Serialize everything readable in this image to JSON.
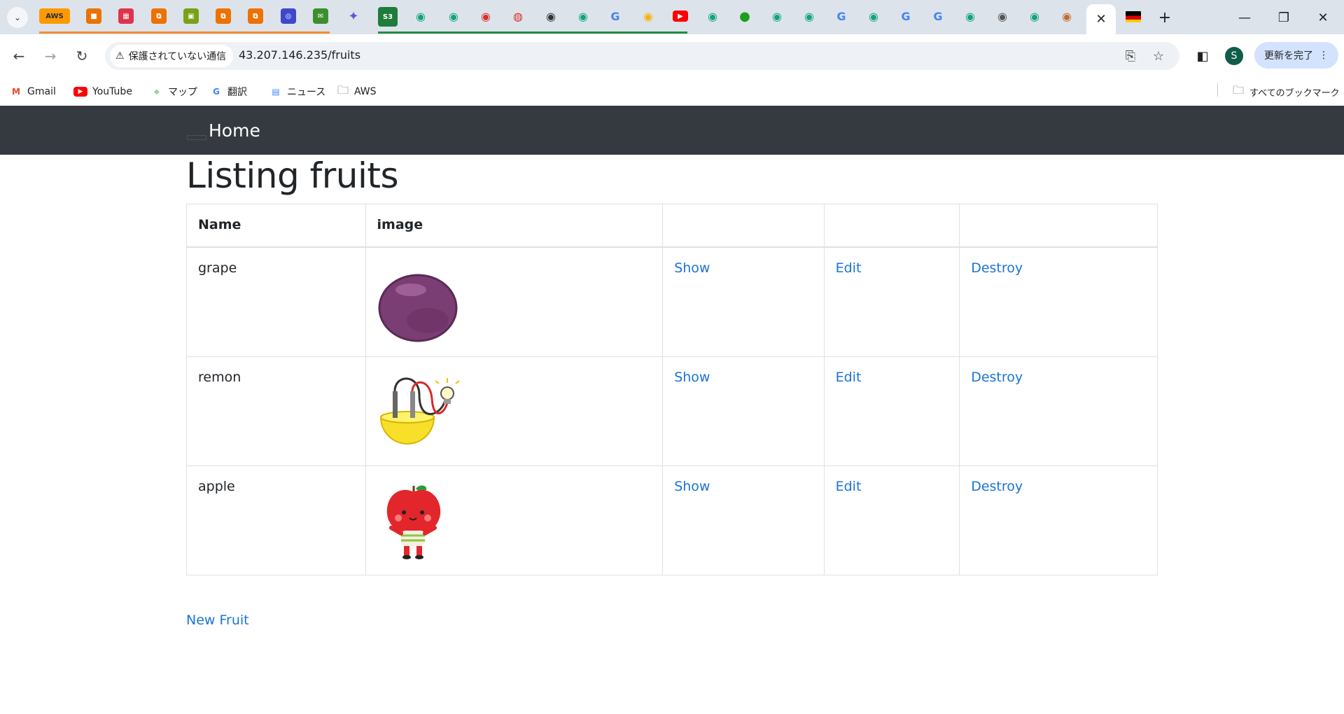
{
  "browser": {
    "tabs": [
      {
        "icon": "tab-search-icon"
      },
      {
        "icon": "aws-icon",
        "label": "AWS",
        "color": "#ff9900"
      },
      {
        "icon": "aws-service-icon",
        "color": "#ed7100"
      },
      {
        "icon": "calendar-icon",
        "color": "#dd344c"
      },
      {
        "icon": "aws-service-icon",
        "color": "#ed7100"
      },
      {
        "icon": "aws-service-icon",
        "color": "#7aa116"
      },
      {
        "icon": "aws-service-icon",
        "color": "#ed7100"
      },
      {
        "icon": "aws-service-icon",
        "color": "#ed7100"
      },
      {
        "icon": "aws-service-icon",
        "color": "#3f48cc"
      },
      {
        "icon": "aws-service-icon",
        "color": "#3b8f2f"
      },
      {
        "icon": "sparkle-icon",
        "color": "#5b5bd6"
      },
      {
        "icon": "s3-icon",
        "label": "S3",
        "color": "#1e7d3a"
      },
      {
        "icon": "chatgpt-icon",
        "color": "#10a37f"
      }
    ],
    "active_tab_close": "✕",
    "new_tab": "+",
    "window": {
      "minimize": "—",
      "restore": "❐",
      "close": "✕"
    },
    "address": {
      "security_label": "保護されていない通信",
      "url": "43.207.146.235/fruits"
    },
    "avatar_letter": "S",
    "update_button": "更新を完了",
    "bookmarks": [
      {
        "label": "Gmail",
        "icon": "gmail-icon",
        "color": "#ea4335"
      },
      {
        "label": "YouTube",
        "icon": "youtube-icon",
        "color": "#ff0000"
      },
      {
        "label": "マップ",
        "icon": "maps-icon",
        "color": "#34a853"
      },
      {
        "label": "翻訳",
        "icon": "translate-icon",
        "color": "#4285f4"
      },
      {
        "label": "ニュース",
        "icon": "news-icon",
        "color": "#4285f4"
      },
      {
        "label": "AWS",
        "icon": "folder-icon",
        "color": "#444444"
      }
    ],
    "all_bookmarks": "すべてのブックマーク"
  },
  "navbar": {
    "home": "Home"
  },
  "page": {
    "title": "Listing fruits",
    "headers": {
      "name": "Name",
      "image": "image"
    },
    "rows": [
      {
        "name": "grape",
        "image": "grape-image",
        "show": "Show",
        "edit": "Edit",
        "destroy": "Destroy"
      },
      {
        "name": "remon",
        "image": "lemon-battery-image",
        "show": "Show",
        "edit": "Edit",
        "destroy": "Destroy"
      },
      {
        "name": "apple",
        "image": "apple-character-image",
        "show": "Show",
        "edit": "Edit",
        "destroy": "Destroy"
      }
    ],
    "new_link": "New Fruit"
  }
}
